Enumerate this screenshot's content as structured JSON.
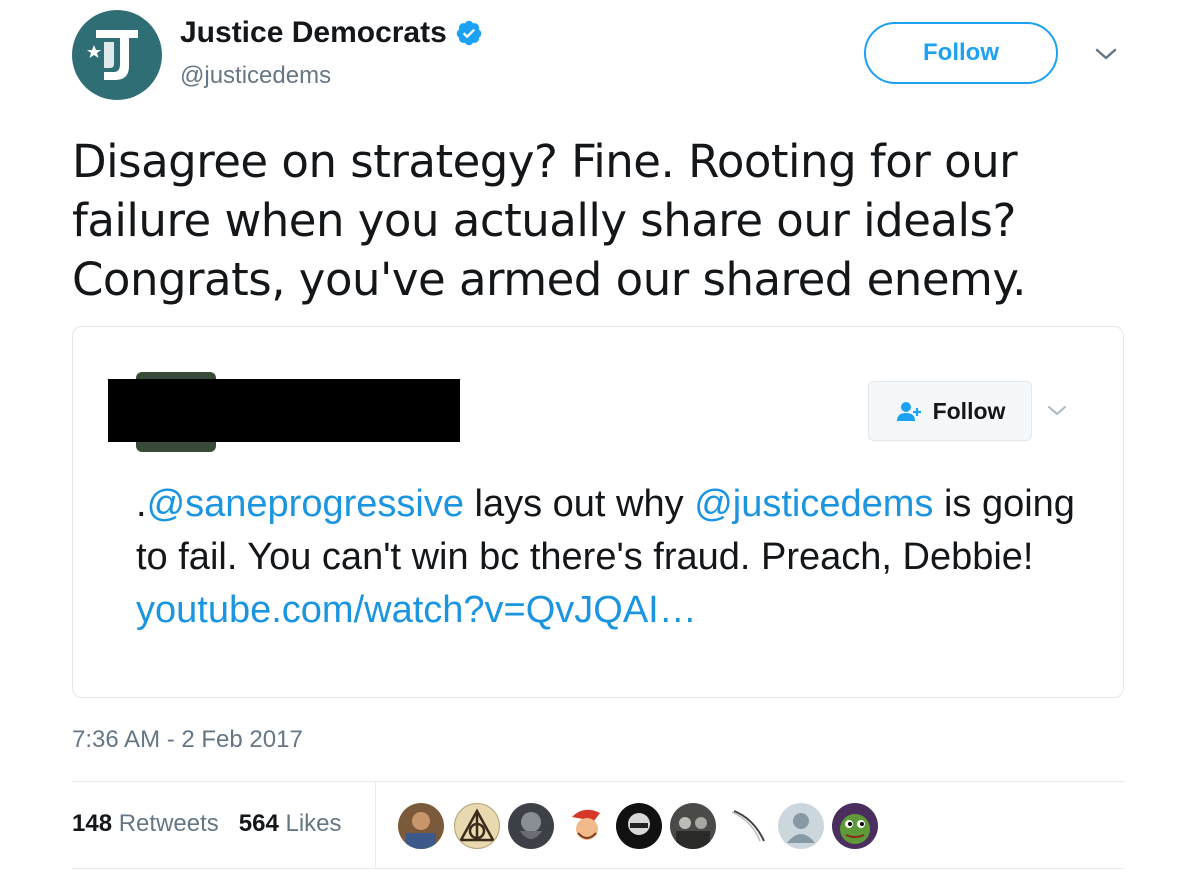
{
  "author": {
    "name": "Justice Democrats",
    "handle": "@justicedems",
    "avatar_icon": "justice-democrats-logo",
    "avatar_color": "#2f6e74"
  },
  "header": {
    "follow_label": "Follow"
  },
  "tweet": {
    "text_line1": "Disagree on strategy? Fine. Rooting for our",
    "text_line2": "failure when you actually share our ideals?",
    "text_line3": "Congrats, you've armed our shared enemy."
  },
  "quote": {
    "follow_label": "Follow",
    "text_prefix": ".",
    "mention1": "@saneprogressive",
    "text_mid": " lays out why ",
    "mention2": "@justicedems",
    "text_after": " is going to fail. You can't win bc there's fraud. Preach, Debbie! ",
    "link": "youtube.com/watch?v=QvJQAI…"
  },
  "meta": {
    "timestamp": "7:36 AM - 2 Feb 2017"
  },
  "stats": {
    "retweets_count": "148",
    "retweets_label": "Retweets",
    "likes_count": "564",
    "likes_label": "Likes"
  },
  "colors": {
    "accent": "#1da1f2",
    "link": "#1b95e0",
    "muted": "#657786"
  }
}
